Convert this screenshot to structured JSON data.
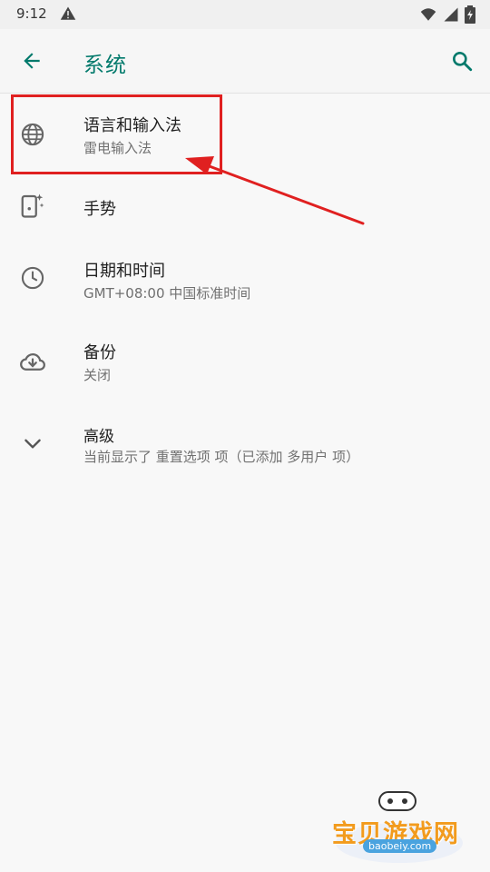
{
  "status_bar": {
    "time": "9:12"
  },
  "app_bar": {
    "title": "系统"
  },
  "items": [
    {
      "title": "语言和输入法",
      "subtitle": "雷电输入法",
      "icon": "globe-icon"
    },
    {
      "title": "手势",
      "subtitle": "",
      "icon": "gesture-phone-icon"
    },
    {
      "title": "日期和时间",
      "subtitle": "GMT+08:00 中国标准时间",
      "icon": "clock-icon"
    },
    {
      "title": "备份",
      "subtitle": "关闭",
      "icon": "cloud-backup-icon"
    },
    {
      "title": "高级",
      "subtitle": "当前显示了 重置选项 项（已添加 多用户 项）",
      "icon": "chevron-down-icon"
    }
  ],
  "watermark": {
    "name": "宝贝游戏网",
    "url": "baobeiy.com"
  },
  "colors": {
    "accent": "#00796b",
    "highlight": "#e02020"
  }
}
